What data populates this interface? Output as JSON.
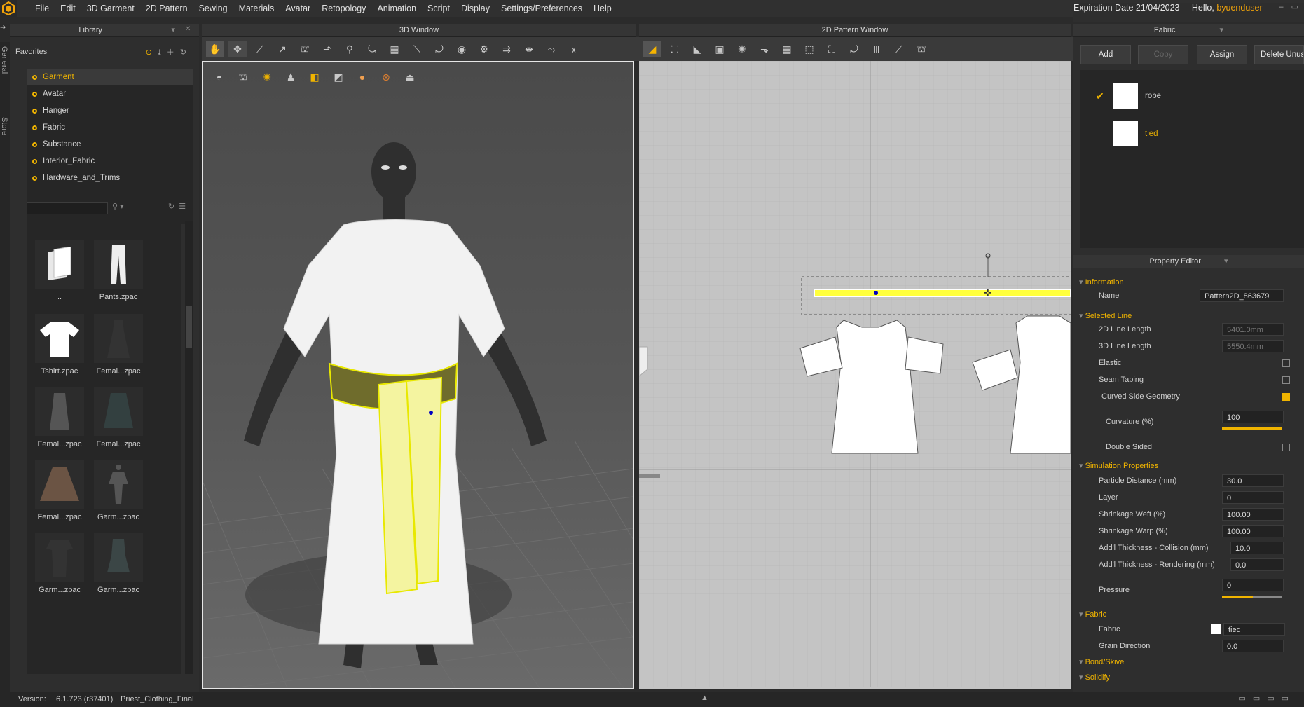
{
  "menu": {
    "items": [
      "File",
      "Edit",
      "3D Garment",
      "2D Pattern",
      "Sewing",
      "Materials",
      "Avatar",
      "Retopology",
      "Animation",
      "Script",
      "Display",
      "Settings/Preferences",
      "Help"
    ],
    "expiration": "Expiration Date 21/04/2023",
    "hello": "Hello,",
    "user": "byuenduser"
  },
  "side_tabs": [
    "General",
    "Store"
  ],
  "library": {
    "title": "Library",
    "favorites_label": "Favorites",
    "favorites": [
      "Garment",
      "Avatar",
      "Hanger",
      "Fabric",
      "Substance",
      "Interior_Fabric",
      "Hardware_and_Trims"
    ],
    "selected_favorite": "Garment",
    "thumbs": [
      "..",
      "Pants.zpac",
      "Tshirt.zpac",
      "Femal...zpac",
      "Femal...zpac",
      "Femal...zpac",
      "Femal...zpac",
      "Garm...zpac",
      "Garm...zpac",
      "Garm...zpac"
    ]
  },
  "window3d": {
    "title": "3D Window"
  },
  "window2d": {
    "title": "2D Pattern Window"
  },
  "fabric_panel": {
    "title": "Fabric",
    "buttons": {
      "add": "Add",
      "copy": "Copy",
      "assign": "Assign",
      "delete": "Delete Unus"
    },
    "fabrics": [
      {
        "name": "robe",
        "checked": true
      },
      {
        "name": "tied",
        "checked": false
      }
    ]
  },
  "property_editor": {
    "title": "Property Editor",
    "information": "Information",
    "name_label": "Name",
    "name_value": "Pattern2D_863679",
    "selected_line": "Selected Line",
    "line2d_label": "2D Line Length",
    "line2d_value": "5401.0mm",
    "line3d_label": "3D Line Length",
    "line3d_value": "5550.4mm",
    "elastic_label": "Elastic",
    "seam_taping_label": "Seam Taping",
    "curved_label": "Curved Side Geometry",
    "curvature_label": "Curvature (%)",
    "curvature_value": "100",
    "double_sided_label": "Double Sided",
    "simulation": "Simulation Properties",
    "particle_label": "Particle Distance (mm)",
    "particle_value": "30.0",
    "layer_label": "Layer",
    "layer_value": "0",
    "weft_label": "Shrinkage Weft (%)",
    "weft_value": "100.00",
    "warp_label": "Shrinkage Warp (%)",
    "warp_value": "100.00",
    "collision_label": "Add'l Thickness - Collision (mm)",
    "collision_value": "10.0",
    "rendering_label": "Add'l Thickness - Rendering (mm)",
    "rendering_value": "0.0",
    "pressure_label": "Pressure",
    "pressure_value": "0",
    "fabric_section": "Fabric",
    "fabric_label": "Fabric",
    "fabric_value": "tied",
    "grain_label": "Grain Direction",
    "grain_value": "0.0",
    "bond": "Bond/Skive",
    "solidify": "Solidify"
  },
  "status": {
    "version_label": "Version:",
    "version": "6.1.723 (r37401)",
    "file": "Priest_Clothing_Final"
  },
  "colors": {
    "accent": "#f0b400",
    "selection": "#ffff3c"
  }
}
